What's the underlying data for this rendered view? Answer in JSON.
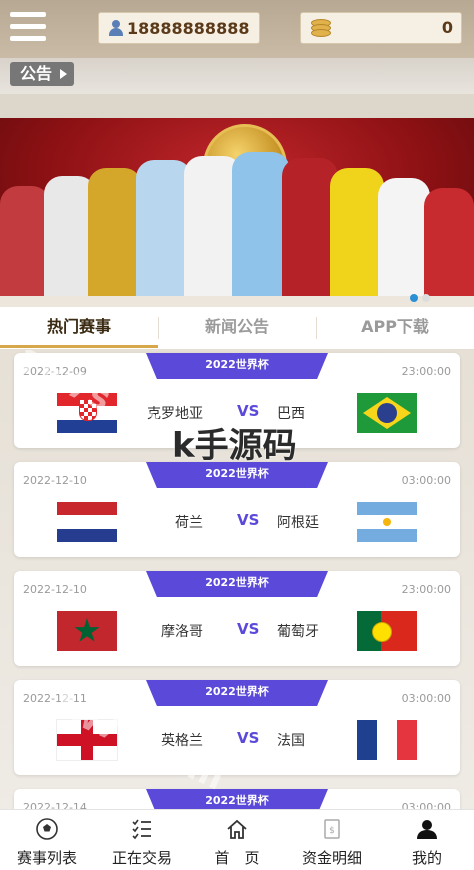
{
  "header": {
    "phone": "18888888888",
    "balance": "0"
  },
  "notice": {
    "label": "公告"
  },
  "tabs": [
    {
      "label": "热门赛事"
    },
    {
      "label": "新闻公告"
    },
    {
      "label": "APP下载"
    }
  ],
  "watermark": {
    "overlay_text": "k手源码"
  },
  "matches": [
    {
      "league": "2022世界杯",
      "date": "2022-12-09",
      "time": "23:00:00",
      "home": "克罗地亚",
      "away": "巴西",
      "vs": "VS",
      "home_flag": "croatia",
      "away_flag": "brazil"
    },
    {
      "league": "2022世界杯",
      "date": "2022-12-10",
      "time": "03:00:00",
      "home": "荷兰",
      "away": "阿根廷",
      "vs": "VS",
      "home_flag": "netherlands",
      "away_flag": "argentina"
    },
    {
      "league": "2022世界杯",
      "date": "2022-12-10",
      "time": "23:00:00",
      "home": "摩洛哥",
      "away": "葡萄牙",
      "vs": "VS",
      "home_flag": "morocco",
      "away_flag": "portugal"
    },
    {
      "league": "2022世界杯",
      "date": "2022-12-11",
      "time": "03:00:00",
      "home": "英格兰",
      "away": "法国",
      "vs": "VS",
      "home_flag": "england",
      "away_flag": "france"
    },
    {
      "league": "2022世界杯",
      "date": "2022-12-14",
      "time": "03:00:00"
    }
  ],
  "bottom_nav": [
    {
      "label": "赛事列表",
      "icon": "soccer-ball-icon"
    },
    {
      "label": "正在交易",
      "icon": "list-check-icon"
    },
    {
      "label": "首　页",
      "icon": "home-icon"
    },
    {
      "label": "资金明细",
      "icon": "money-doc-icon"
    },
    {
      "label": "我的",
      "icon": "user-icon"
    }
  ],
  "colors": {
    "accent": "#5b49d9",
    "tab_underline": "#d7a84a",
    "carousel_active": "#2b8fd6"
  }
}
